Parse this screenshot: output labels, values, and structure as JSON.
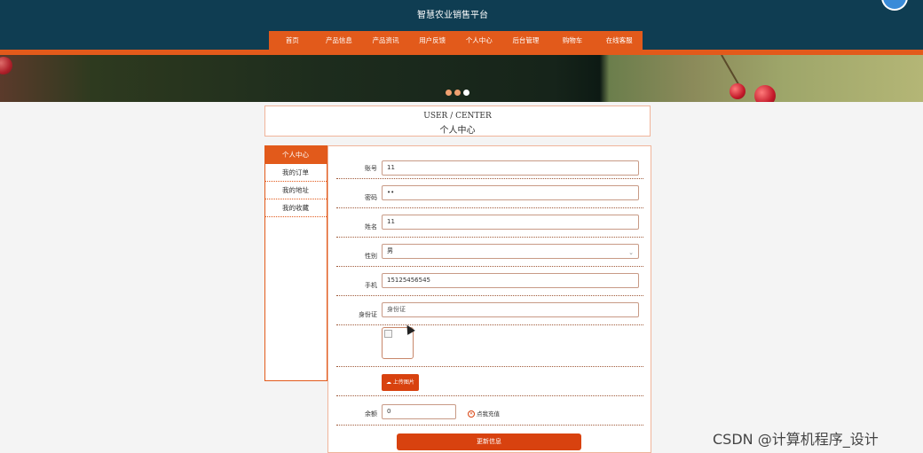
{
  "header": {
    "site_title": "智慧农业销售平台",
    "nav": [
      "首页",
      "产品信息",
      "产品资讯",
      "用户反馈",
      "个人中心",
      "后台管理",
      "购物车",
      "在线客服"
    ]
  },
  "banner": {
    "dot_colors": [
      "#f0a070",
      "#f0a070",
      "#ffffff"
    ]
  },
  "panel": {
    "title_en": "USER / CENTER",
    "title_cn": "个人中心"
  },
  "sidebar": {
    "items": [
      "个人中心",
      "我的订单",
      "我的地址",
      "我的收藏"
    ],
    "active_index": 0
  },
  "form": {
    "account": {
      "label": "账号",
      "value": "11"
    },
    "password": {
      "label": "密码",
      "value": "••"
    },
    "name": {
      "label": "姓名",
      "value": "11"
    },
    "gender": {
      "label": "性别",
      "value": "男"
    },
    "phone": {
      "label": "手机",
      "value": "15125456545"
    },
    "id_card": {
      "label": "身份证",
      "placeholder": "身份证"
    },
    "upload_label": "上传图片",
    "balance": {
      "label": "余额",
      "value": "0"
    },
    "recharge_label": "点我充值",
    "submit_label": "更新信息"
  },
  "watermark": "CSDN @计算机程序_设计",
  "colors": {
    "header_bg": "#0f3d52",
    "accent": "#e25a1b",
    "button": "#d8420f"
  }
}
